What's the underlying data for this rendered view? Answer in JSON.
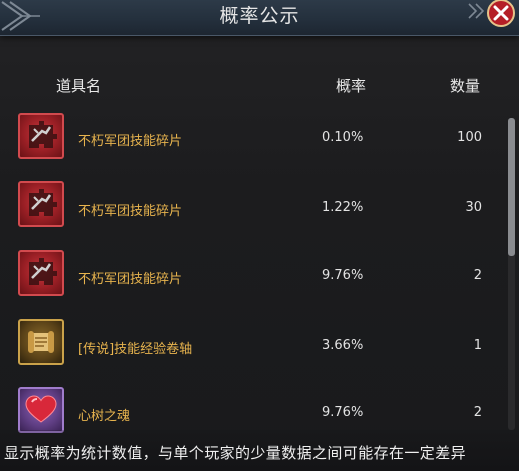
{
  "title": "概率公示",
  "header": {
    "name_label": "道具名",
    "rate_label": "概率",
    "count_label": "数量"
  },
  "items": [
    {
      "name": "不朽军团技能碎片",
      "rate": "0.10%",
      "count": "100",
      "icon": "skill-fragment-icon",
      "rarity": "red"
    },
    {
      "name": "不朽军团技能碎片",
      "rate": "1.22%",
      "count": "30",
      "icon": "skill-fragment-icon",
      "rarity": "red"
    },
    {
      "name": "不朽军团技能碎片",
      "rate": "9.76%",
      "count": "2",
      "icon": "skill-fragment-icon",
      "rarity": "red"
    },
    {
      "name": "[传说]技能经验卷轴",
      "rate": "3.66%",
      "count": "1",
      "icon": "scroll-icon",
      "rarity": "gold"
    },
    {
      "name": "心树之魂",
      "rate": "9.76%",
      "count": "2",
      "icon": "heart-icon",
      "rarity": "purple"
    }
  ],
  "footer": {
    "note": "显示概率为统计数值，与单个玩家的少量数据之间可能存在一定差异"
  },
  "colors": {
    "item_name": "#e8b44e",
    "title_bar": "#24303d",
    "close_button": "#b51f27"
  }
}
